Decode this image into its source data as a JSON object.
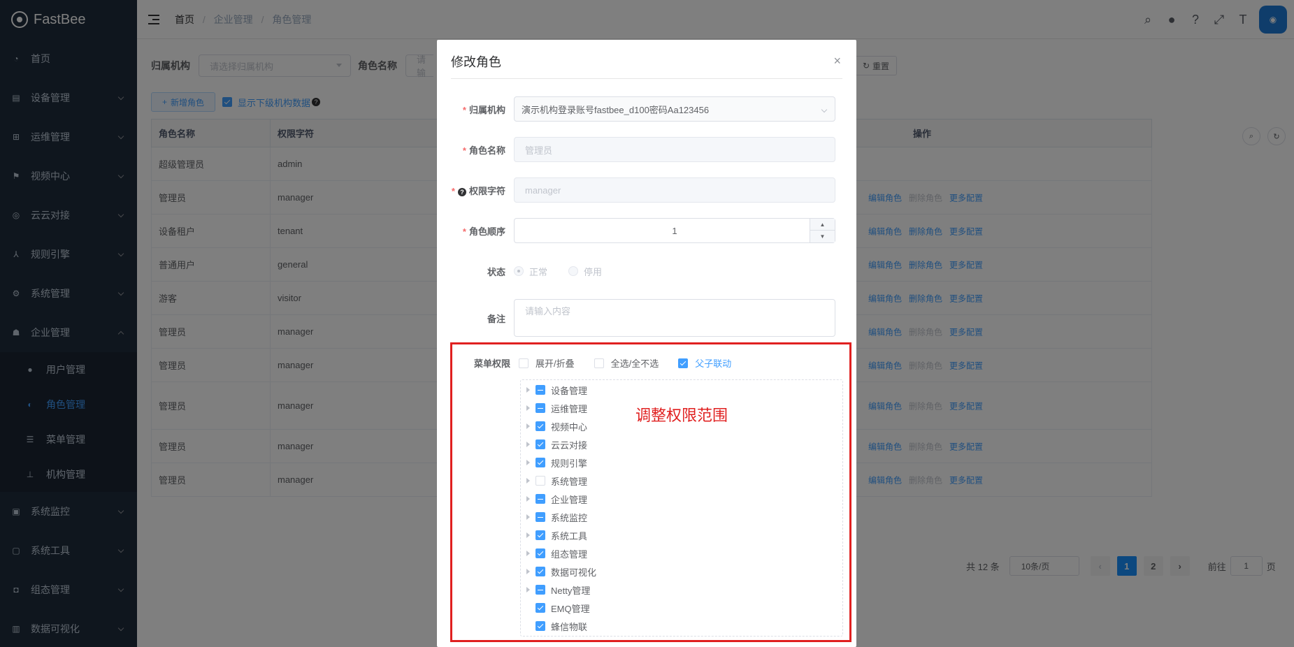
{
  "app": {
    "logo_text": "FastBee"
  },
  "sidebar": {
    "items": [
      {
        "label": "首页",
        "icon": "dashboard-icon"
      },
      {
        "label": "设备管理",
        "icon": "device-icon"
      },
      {
        "label": "运维管理",
        "icon": "ops-icon"
      },
      {
        "label": "视频中心",
        "icon": "video-icon"
      },
      {
        "label": "云云对接",
        "icon": "cloud-icon"
      },
      {
        "label": "规则引擎",
        "icon": "rule-icon"
      },
      {
        "label": "系统管理",
        "icon": "gear-icon"
      },
      {
        "label": "企业管理",
        "icon": "enterprise-icon"
      }
    ],
    "sub_items": [
      {
        "label": "用户管理",
        "icon": "user-icon"
      },
      {
        "label": "角色管理",
        "icon": "role-icon"
      },
      {
        "label": "菜单管理",
        "icon": "menu-icon"
      },
      {
        "label": "机构管理",
        "icon": "org-icon"
      }
    ],
    "after_items": [
      {
        "label": "系统监控",
        "icon": "monitor-icon"
      },
      {
        "label": "系统工具",
        "icon": "tools-icon"
      },
      {
        "label": "组态管理",
        "icon": "scada-icon"
      },
      {
        "label": "数据可视化",
        "icon": "chart-icon"
      }
    ]
  },
  "breadcrumb": [
    "首页",
    "企业管理",
    "角色管理"
  ],
  "search": {
    "org_label": "归属机构",
    "org_placeholder": "请选择归属机构",
    "role_label": "角色名称",
    "role_placeholder": "请输",
    "reset_label": "重置"
  },
  "toolbar": {
    "add_label": "新增角色",
    "show_sub_label": "显示下级机构数据"
  },
  "table": {
    "headers": {
      "name": "角色名称",
      "key": "权限字符",
      "ops": "操作"
    },
    "rows": [
      {
        "name": "超级管理员",
        "key": "admin"
      },
      {
        "name": "管理员",
        "key": "manager"
      },
      {
        "name": "设备租户",
        "key": "tenant"
      },
      {
        "name": "普通用户",
        "key": "general"
      },
      {
        "name": "游客",
        "key": "visitor"
      },
      {
        "name": "管理员",
        "key": "manager"
      },
      {
        "name": "管理员",
        "key": "manager"
      },
      {
        "name": "管理员",
        "key": "manager"
      },
      {
        "name": "管理员",
        "key": "manager"
      },
      {
        "name": "管理员",
        "key": "manager"
      }
    ],
    "op_edit": "编辑角色",
    "op_delete": "删除角色",
    "op_more": "更多配置"
  },
  "pagination": {
    "total": "共 12 条",
    "page_size": "10条/页",
    "pages": [
      "1",
      "2"
    ],
    "goto_prefix": "前往",
    "goto_value": "1",
    "goto_suffix": "页"
  },
  "dialog": {
    "title": "修改角色",
    "close": "×",
    "org_label": "归属机构",
    "org_value": "演示机构登录账号fastbee_d100密码Aa123456",
    "name_label": "角色名称",
    "name_value": "管理员",
    "key_label": "权限字符",
    "key_value": "manager",
    "order_label": "角色顺序",
    "order_value": "1",
    "status_label": "状态",
    "status_normal": "正常",
    "status_disabled": "停用",
    "remark_label": "备注",
    "remark_placeholder": "请输入内容",
    "perm_label": "菜单权限",
    "perm_expand": "展开/折叠",
    "perm_select_all": "全选/全不选",
    "perm_linkage": "父子联动",
    "annotation": "调整权限范围",
    "tree": [
      {
        "label": "设备管理",
        "state": "indeterminate"
      },
      {
        "label": "运维管理",
        "state": "indeterminate"
      },
      {
        "label": "视频中心",
        "state": "checked"
      },
      {
        "label": "云云对接",
        "state": "checked"
      },
      {
        "label": "规则引擎",
        "state": "checked"
      },
      {
        "label": "系统管理",
        "state": "unchecked"
      },
      {
        "label": "企业管理",
        "state": "indeterminate"
      },
      {
        "label": "系统监控",
        "state": "indeterminate"
      },
      {
        "label": "系统工具",
        "state": "checked"
      },
      {
        "label": "组态管理",
        "state": "checked"
      },
      {
        "label": "数据可视化",
        "state": "checked"
      },
      {
        "label": "Netty管理",
        "state": "indeterminate"
      },
      {
        "label": "EMQ管理",
        "state": "checked",
        "leaf": true
      },
      {
        "label": "蜂信物联",
        "state": "checked",
        "leaf": true
      }
    ]
  }
}
